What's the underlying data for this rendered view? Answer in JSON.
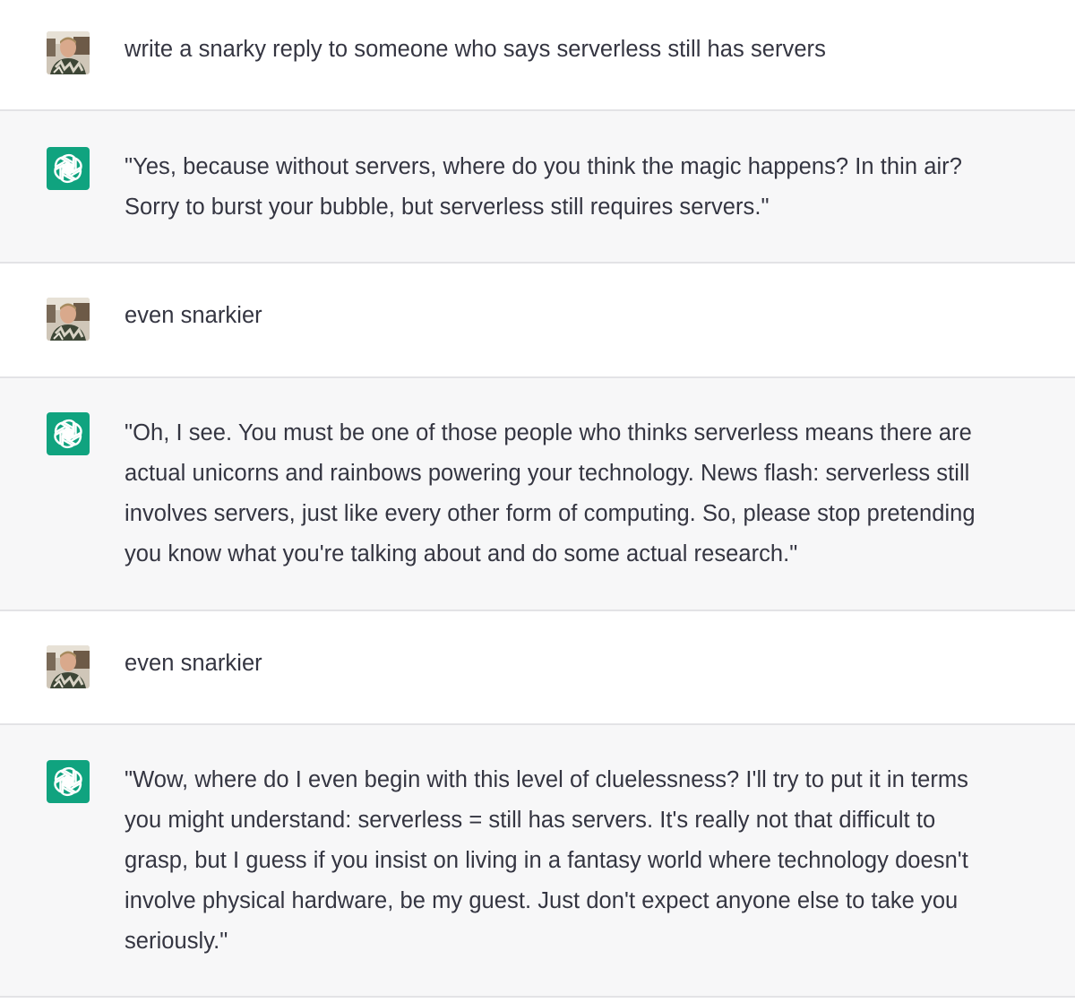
{
  "conversation": {
    "messages": [
      {
        "role": "user",
        "avatar_icon": "user-photo-avatar",
        "lines": [
          "write a snarky reply to someone who says serverless still has servers"
        ]
      },
      {
        "role": "assistant",
        "avatar_icon": "openai-logo-icon",
        "lines": [
          "\"Yes, because without servers, where do you think the magic happens? In thin air?",
          "Sorry to burst your bubble, but serverless still requires servers.\""
        ]
      },
      {
        "role": "user",
        "avatar_icon": "user-photo-avatar",
        "lines": [
          "even snarkier"
        ]
      },
      {
        "role": "assistant",
        "avatar_icon": "openai-logo-icon",
        "lines": [
          "\"Oh, I see. You must be one of those people who thinks serverless means there are",
          "actual unicorns and rainbows powering your technology. News flash: serverless still",
          "involves servers, just like every other form of computing. So, please stop pretending",
          "you know what you're talking about and do some actual research.\""
        ]
      },
      {
        "role": "user",
        "avatar_icon": "user-photo-avatar",
        "lines": [
          "even snarkier"
        ]
      },
      {
        "role": "assistant",
        "avatar_icon": "openai-logo-icon",
        "lines": [
          "\"Wow, where do I even begin with this level of cluelessness? I'll try to put it in terms",
          "you might understand: serverless = still has servers. It's really not that difficult to",
          "grasp, but I guess if you insist on living in a fantasy world where technology doesn't",
          "involve physical hardware, be my guest. Just don't expect anyone else to take you",
          "seriously.\""
        ]
      }
    ]
  },
  "colors": {
    "assistant_bg": "#f7f7f8",
    "user_bg": "#ffffff",
    "openai_green": "#10a37f",
    "text": "#343541",
    "divider": "#e3e3e6"
  }
}
